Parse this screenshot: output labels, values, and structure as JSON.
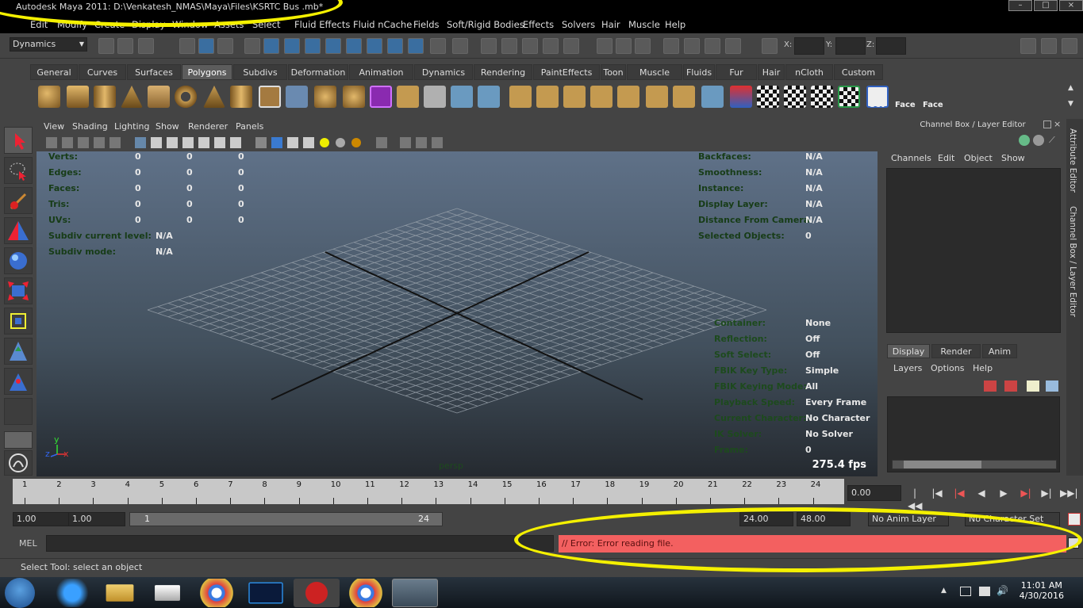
{
  "window": {
    "title": "Autodesk Maya 2011: D:\\Venkatesh_NMAS\\Maya\\Files\\KSRTC Bus .mb*"
  },
  "menu": [
    "Edit",
    "Modify",
    "Create",
    "Display",
    "Window",
    "Assets",
    "Select",
    "Fluid Effects",
    "Fluid nCache",
    "Fields",
    "Soft/Rigid Bodies",
    "Effects",
    "Solvers",
    "Hair",
    "Muscle",
    "Help"
  ],
  "status_line": {
    "mode": "Dynamics",
    "x_label": "X:",
    "y_label": "Y:",
    "z_label": "Z:"
  },
  "shelf": {
    "tabs": [
      "General",
      "Curves",
      "Surfaces",
      "Polygons",
      "Subdivs",
      "Deformation",
      "Animation",
      "Dynamics",
      "Rendering",
      "PaintEffects",
      "Toon",
      "Muscle",
      "Fluids",
      "Fur",
      "Hair",
      "nCloth",
      "Custom"
    ],
    "active_tab": "Polygons",
    "text_buttons": [
      "Set",
      "Face",
      "Face"
    ]
  },
  "viewport": {
    "menu": [
      "View",
      "Shading",
      "Lighting",
      "Show",
      "Renderer",
      "Panels"
    ],
    "hud_left": [
      {
        "label": "Verts:",
        "v1": "0",
        "v2": "0",
        "v3": "0"
      },
      {
        "label": "Edges:",
        "v1": "0",
        "v2": "0",
        "v3": "0"
      },
      {
        "label": "Faces:",
        "v1": "0",
        "v2": "0",
        "v3": "0"
      },
      {
        "label": "Tris:",
        "v1": "0",
        "v2": "0",
        "v3": "0"
      },
      {
        "label": "UVs:",
        "v1": "0",
        "v2": "0",
        "v3": "0"
      }
    ],
    "subdiv_level_label": "Subdiv current level:",
    "subdiv_level_value": "N/A",
    "subdiv_mode_label": "Subdiv mode:",
    "subdiv_mode_value": "N/A",
    "hud_right_top": [
      {
        "label": "Backfaces:",
        "value": "N/A"
      },
      {
        "label": "Smoothness:",
        "value": "N/A"
      },
      {
        "label": "Instance:",
        "value": "N/A"
      },
      {
        "label": "Display Layer:",
        "value": "N/A"
      },
      {
        "label": "Distance From Camera:",
        "value": "N/A"
      },
      {
        "label": "Selected Objects:",
        "value": "0"
      }
    ],
    "hud_right_bottom": [
      {
        "label": "Container:",
        "value": "None"
      },
      {
        "label": "Reflection:",
        "value": "Off"
      },
      {
        "label": "Soft Select:",
        "value": "Off"
      },
      {
        "label": "FBIK Key Type:",
        "value": "Simple"
      },
      {
        "label": "FBIK Keying Mode:",
        "value": "All"
      },
      {
        "label": "Playback Speed:",
        "value": "Every Frame"
      },
      {
        "label": "Current Character:",
        "value": "No Character"
      },
      {
        "label": "IK Solver:",
        "value": "No Solver"
      },
      {
        "label": "Frame:",
        "value": "0"
      }
    ],
    "camera": "persp",
    "fps": "275.4 fps",
    "axis_y": "y",
    "axis_x": "x",
    "axis_z": "z"
  },
  "channel_box": {
    "title": "Channel Box / Layer Editor",
    "menu": [
      "Channels",
      "Edit",
      "Object",
      "Show"
    ],
    "layer_tabs": [
      "Display",
      "Render",
      "Anim"
    ],
    "layer_menu": [
      "Layers",
      "Options",
      "Help"
    ],
    "side_tabs": [
      "Attribute Editor",
      "Channel Box / Layer Editor"
    ]
  },
  "time_slider": {
    "labels": [
      "1",
      "2",
      "3",
      "4",
      "5",
      "6",
      "7",
      "8",
      "9",
      "10",
      "11",
      "12",
      "13",
      "14",
      "15",
      "16",
      "17",
      "18",
      "19",
      "20",
      "21",
      "22",
      "23",
      "24"
    ],
    "current_time": "0.00"
  },
  "range_slider": {
    "start_time": "1.00",
    "playback_start": "1.00",
    "range_start": "1",
    "range_end": "24",
    "playback_end": "24.00",
    "end_time": "48.00",
    "anim_layer": "No Anim Layer",
    "character": "No Character Set"
  },
  "command_line": {
    "label": "MEL",
    "error": "// Error: Error reading file."
  },
  "help_line": "Select Tool: select an object",
  "taskbar": {
    "time": "11:01 AM",
    "date": "4/30/2016"
  },
  "colors": {
    "error_bg": "#f36060",
    "annotation": "#f4f000"
  }
}
